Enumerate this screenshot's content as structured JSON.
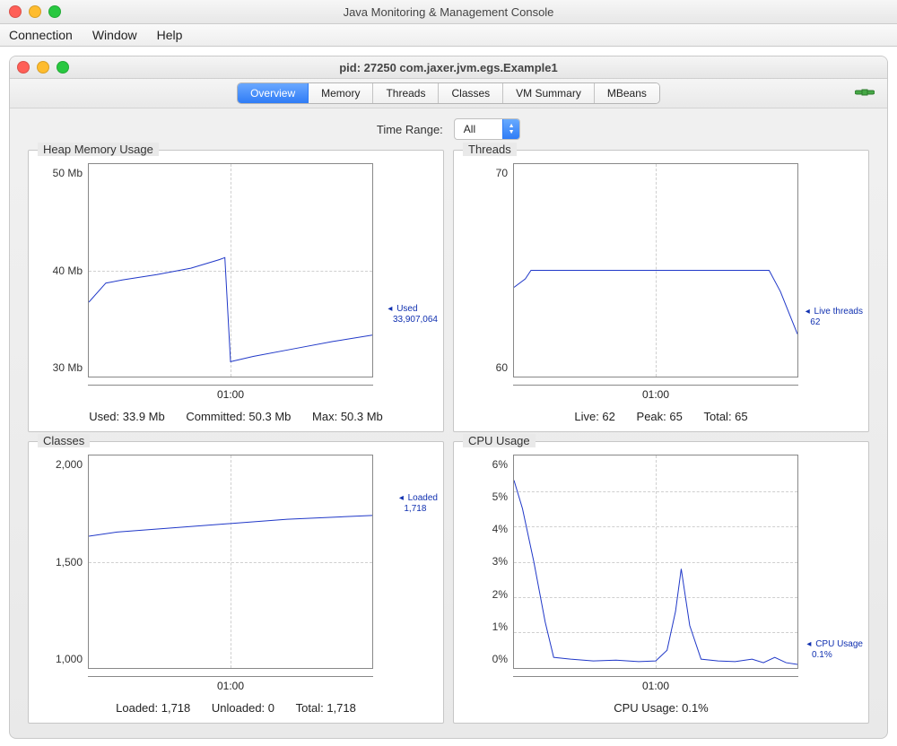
{
  "outer_window": {
    "title": "Java Monitoring & Management Console",
    "menu": [
      "Connection",
      "Window",
      "Help"
    ]
  },
  "inner_window": {
    "title": "pid: 27250 com.jaxer.jvm.egs.Example1"
  },
  "tabs": {
    "items": [
      "Overview",
      "Memory",
      "Threads",
      "Classes",
      "VM Summary",
      "MBeans"
    ],
    "active": "Overview"
  },
  "time_range": {
    "label": "Time Range:",
    "value": "All"
  },
  "panels": {
    "heap": {
      "title": "Heap Memory Usage",
      "yticks": [
        "50 Mb",
        "40 Mb",
        "30 Mb"
      ],
      "xtick": "01:00",
      "callout_label": "Used",
      "callout_value": "33,907,064",
      "stats": {
        "used": "Used: 33.9 Mb",
        "committed": "Committed: 50.3 Mb",
        "max": "Max: 50.3 Mb"
      }
    },
    "threads": {
      "title": "Threads",
      "yticks": [
        "70",
        "60"
      ],
      "xtick": "01:00",
      "callout_label": "Live threads",
      "callout_value": "62",
      "stats": {
        "live": "Live: 62",
        "peak": "Peak: 65",
        "total": "Total: 65"
      }
    },
    "classes": {
      "title": "Classes",
      "yticks": [
        "2,000",
        "1,500",
        "1,000"
      ],
      "xtick": "01:00",
      "callout_label": "Loaded",
      "callout_value": "1,718",
      "stats": {
        "loaded": "Loaded: 1,718",
        "unloaded": "Unloaded: 0",
        "total": "Total: 1,718"
      }
    },
    "cpu": {
      "title": "CPU Usage",
      "yticks": [
        "6%",
        "5%",
        "4%",
        "3%",
        "2%",
        "1%",
        "0%"
      ],
      "xtick": "01:00",
      "callout_label": "CPU Usage",
      "callout_value": "0.1%",
      "stats": {
        "usage": "CPU Usage: 0.1%"
      }
    }
  },
  "chart_data": [
    {
      "name": "heap",
      "type": "line",
      "title": "Heap Memory Usage",
      "xlabel": "",
      "ylabel": "Mb",
      "ylim": [
        30,
        50
      ],
      "x_tick_labels": [
        "01:00"
      ],
      "series": [
        {
          "name": "Used",
          "x_rel": [
            0.0,
            0.06,
            0.12,
            0.24,
            0.36,
            0.46,
            0.48,
            0.5,
            0.58,
            0.72,
            0.86,
            1.0
          ],
          "y": [
            37.0,
            38.8,
            39.1,
            39.6,
            40.2,
            41.0,
            41.2,
            31.4,
            31.9,
            32.6,
            33.3,
            33.9
          ]
        }
      ],
      "annotations": [
        {
          "text": "Used 33,907,064",
          "at_y": 33.9,
          "side": "right"
        }
      ]
    },
    {
      "name": "threads",
      "type": "line",
      "title": "Threads",
      "xlabel": "",
      "ylabel": "",
      "ylim": [
        60,
        70
      ],
      "x_tick_labels": [
        "01:00"
      ],
      "series": [
        {
          "name": "Live threads",
          "x_rel": [
            0.0,
            0.04,
            0.06,
            0.9,
            0.94,
            0.97,
            1.0
          ],
          "y": [
            64.2,
            64.6,
            65.0,
            65.0,
            64.0,
            63.0,
            62.0
          ]
        }
      ],
      "annotations": [
        {
          "text": "Live threads 62",
          "at_y": 62,
          "side": "right"
        }
      ]
    },
    {
      "name": "classes",
      "type": "line",
      "title": "Classes",
      "xlabel": "",
      "ylabel": "",
      "ylim": [
        1000,
        2000
      ],
      "x_tick_labels": [
        "01:00"
      ],
      "series": [
        {
          "name": "Loaded",
          "x_rel": [
            0.0,
            0.1,
            0.3,
            0.5,
            0.7,
            0.9,
            1.0
          ],
          "y": [
            1620,
            1640,
            1660,
            1680,
            1700,
            1712,
            1718
          ]
        }
      ],
      "annotations": [
        {
          "text": "Loaded 1,718",
          "at_y": 1718,
          "side": "right"
        }
      ]
    },
    {
      "name": "cpu",
      "type": "line",
      "title": "CPU Usage",
      "xlabel": "",
      "ylabel": "%",
      "ylim": [
        0,
        6
      ],
      "x_tick_labels": [
        "01:00"
      ],
      "series": [
        {
          "name": "CPU Usage",
          "x_rel": [
            0.0,
            0.03,
            0.07,
            0.11,
            0.14,
            0.2,
            0.28,
            0.36,
            0.44,
            0.5,
            0.54,
            0.57,
            0.59,
            0.62,
            0.66,
            0.72,
            0.78,
            0.84,
            0.88,
            0.92,
            0.96,
            1.0
          ],
          "y": [
            5.3,
            4.5,
            3.0,
            1.3,
            0.3,
            0.25,
            0.2,
            0.22,
            0.18,
            0.2,
            0.5,
            1.6,
            2.8,
            1.2,
            0.25,
            0.2,
            0.18,
            0.25,
            0.15,
            0.3,
            0.15,
            0.1
          ]
        }
      ],
      "annotations": [
        {
          "text": "CPU Usage 0.1%",
          "at_y": 0.1,
          "side": "right"
        }
      ]
    }
  ]
}
